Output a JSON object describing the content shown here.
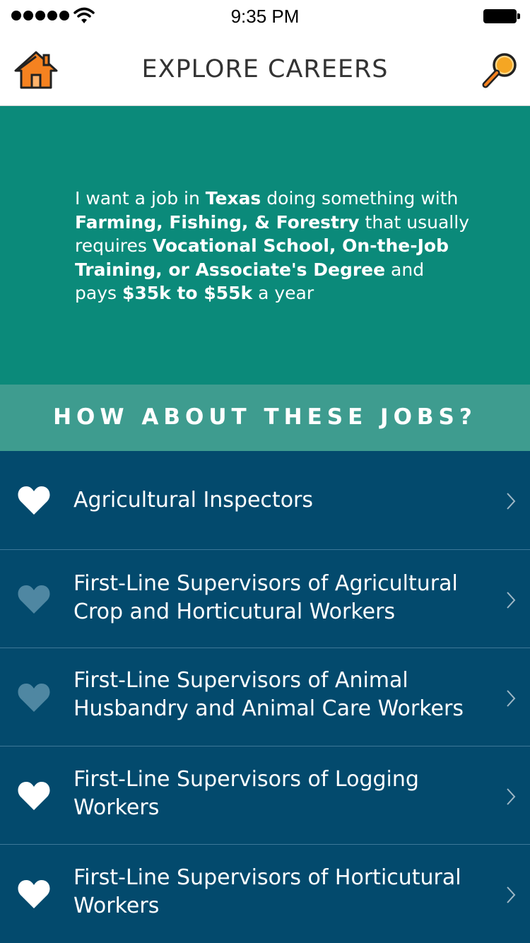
{
  "status_bar": {
    "time": "9:35 PM"
  },
  "nav": {
    "title": "EXPLORE CAREERS",
    "home_icon": "home-icon",
    "search_icon": "magnifier-icon"
  },
  "criteria": {
    "parts": [
      {
        "text": "I want a job in ",
        "bold": false
      },
      {
        "text": "Texas",
        "bold": true
      },
      {
        "text": " doing something with ",
        "bold": false
      },
      {
        "text": "Farming, Fishing, & Forestry",
        "bold": true
      },
      {
        "text": " that usually requires ",
        "bold": false
      },
      {
        "text": "Vocational School, On-the-Job Training, or Associate's Degree",
        "bold": true
      },
      {
        "text": " and pays ",
        "bold": false
      },
      {
        "text": "$35k to $55k",
        "bold": true
      },
      {
        "text": " a year",
        "bold": false
      }
    ]
  },
  "section": {
    "title": "HOW ABOUT THESE JOBS?"
  },
  "jobs": [
    {
      "label_line1": "Agricultural Inspectors",
      "label_line2": "",
      "favorited": true
    },
    {
      "label_line1": "First-Line Supervisors of Agricultural",
      "label_line2": "Crop and Horticutural Workers",
      "favorited": false
    },
    {
      "label_line1": "First-Line Supervisors of Animal",
      "label_line2": "Husbandry and Animal Care Workers",
      "favorited": false
    },
    {
      "label_line1": "First-Line Supervisors of Logging",
      "label_line2": "Workers",
      "favorited": true
    },
    {
      "label_line1": "First-Line Supervisors of Horticutural",
      "label_line2": "Workers",
      "favorited": true
    }
  ],
  "colors": {
    "criteria_bg": "#0b8a7a",
    "section_bg": "#3e9c8f",
    "list_bg": "#034a6d",
    "heart_on": "#ffffff",
    "heart_off": "#4f87a2",
    "home_orange": "#f58220",
    "search_orange": "#f5a623"
  }
}
